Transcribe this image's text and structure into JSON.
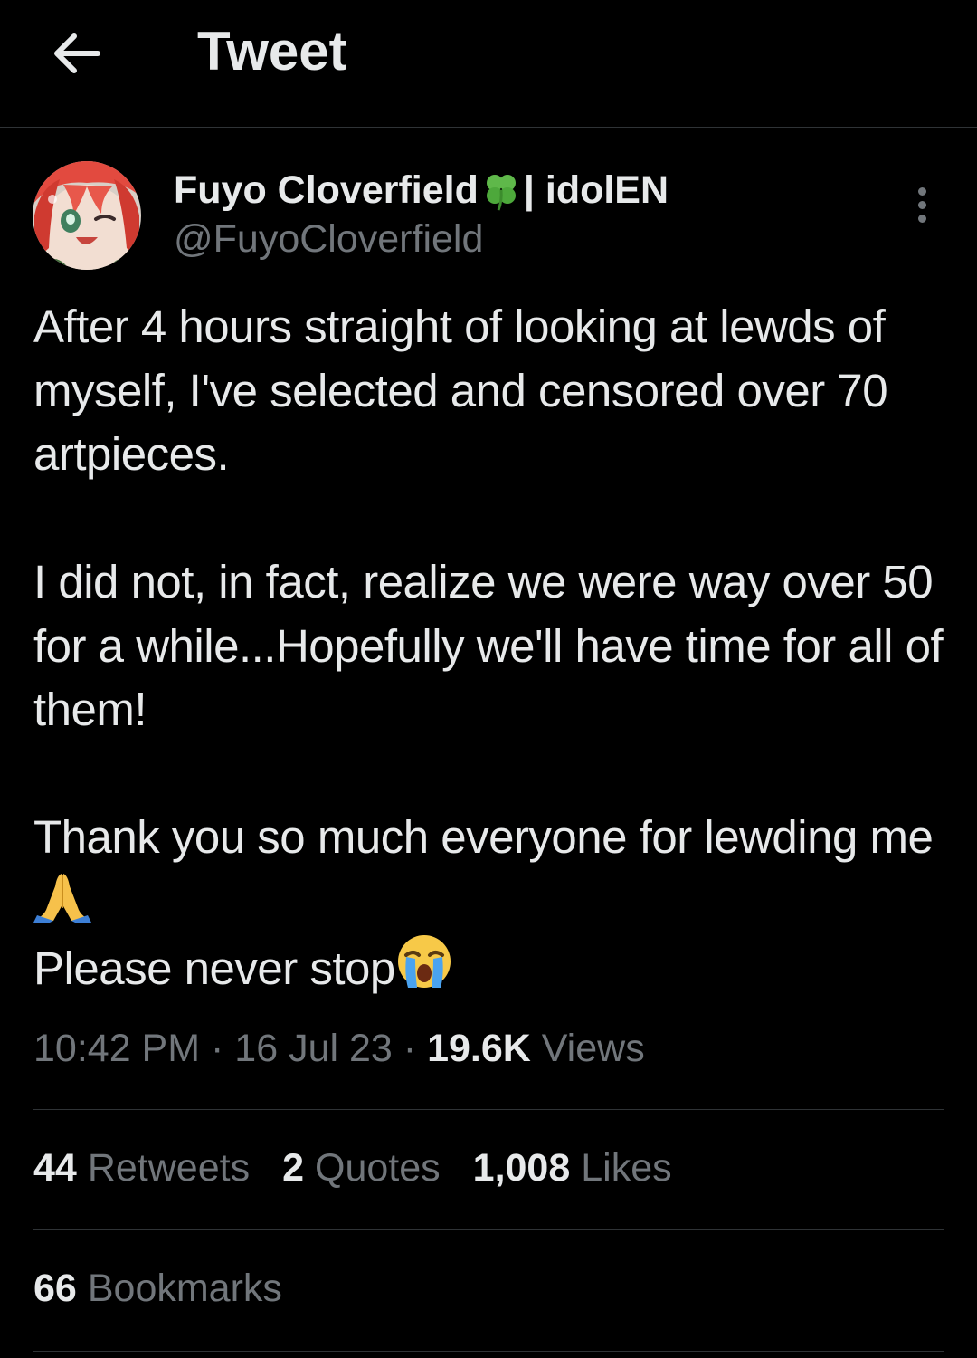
{
  "header": {
    "back_icon": "arrow-left-icon",
    "title": "Tweet"
  },
  "author": {
    "display_name": "Fuyo Cloverfield",
    "name_emoji": "four-leaf-clover-icon",
    "name_suffix": "| idolEN",
    "handle": "@FuyoCloverfield",
    "more_icon": "more-vertical-icon"
  },
  "tweet": {
    "paragraph1": "After 4 hours straight of looking at lewds of myself, I've selected and censored over 70 artpieces.",
    "paragraph2": "I did not, in fact, realize we were way over 50 for a while...Hopefully we'll have time for all of them!",
    "line3a": "Thank you so much everyone for lewding me",
    "line3a_emoji": "folded-hands-emoji",
    "line3b": "Please never stop",
    "line3b_emoji": "loudly-crying-face-emoji"
  },
  "meta": {
    "time": "10:42 PM",
    "separator": "·",
    "date": "16 Jul 23",
    "views_count": "19.6K",
    "views_label": "Views"
  },
  "stats": {
    "retweets_count": "44",
    "retweets_label": "Retweets",
    "quotes_count": "2",
    "quotes_label": "Quotes",
    "likes_count": "1,008",
    "likes_label": "Likes",
    "bookmarks_count": "66",
    "bookmarks_label": "Bookmarks"
  },
  "colors": {
    "background": "#000000",
    "text_primary": "#e7e9ea",
    "text_secondary": "#71767b",
    "divider": "#2f3336"
  }
}
